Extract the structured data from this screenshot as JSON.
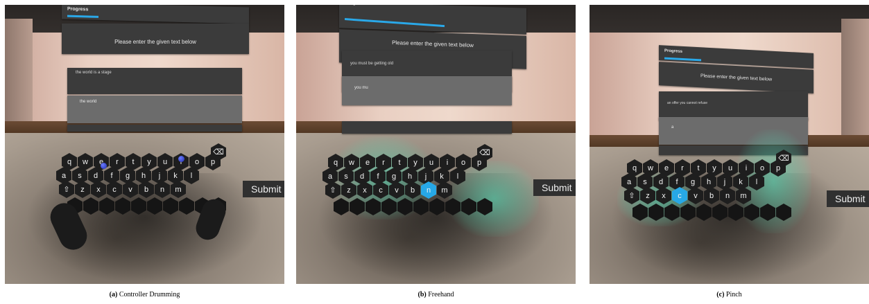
{
  "progress_label": "Progress",
  "instruction": "Please enter the given text below",
  "submit_label": "Submit",
  "accent_color": "#27a8e6",
  "key_rows": [
    [
      "q",
      "w",
      "e",
      "r",
      "t",
      "y",
      "u",
      "i",
      "o",
      "p"
    ],
    [
      "a",
      "s",
      "d",
      "f",
      "g",
      "h",
      "j",
      "k",
      "l"
    ],
    [
      "⇧",
      "z",
      "x",
      "c",
      "v",
      "b",
      "n",
      "m"
    ]
  ],
  "panels": [
    {
      "id": "a",
      "progress": 0.25,
      "phrase": "the world is a stage",
      "typed": "the world",
      "highlight_key": "",
      "caption_label": "(a)",
      "caption_text": "Controller Drumming"
    },
    {
      "id": "b",
      "progress": 0.72,
      "phrase": "you must be getting old",
      "typed": "you mu",
      "highlight_key": "n",
      "caption_label": "(b)",
      "caption_text": "Freehand"
    },
    {
      "id": "c",
      "progress": 0.35,
      "phrase": "an offer you cannot refuse",
      "typed": "a",
      "highlight_key": "c",
      "caption_label": "(c)",
      "caption_text": "Pinch"
    }
  ]
}
